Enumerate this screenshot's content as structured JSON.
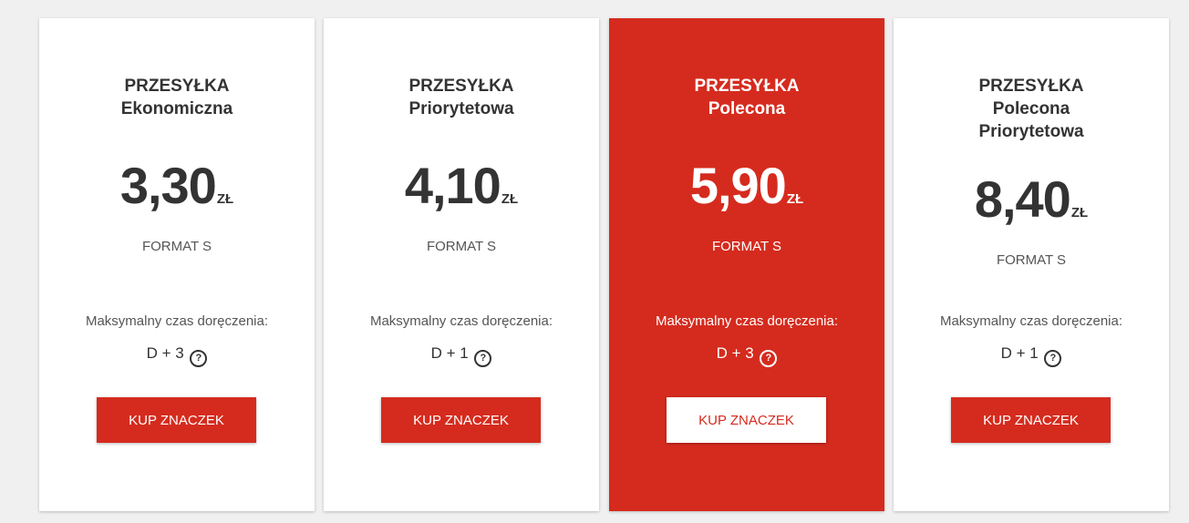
{
  "theme": {
    "accent": "#d52b1e",
    "text": "#333333",
    "card_bg": "#ffffff",
    "page_bg": "#f0f0f0"
  },
  "cards": [
    {
      "title_line1": "PRZESYŁKA",
      "title_line2": "Ekonomiczna",
      "title_line3": "",
      "price": "3,30",
      "currency": "ZŁ",
      "format": "FORMAT S",
      "delivery_label": "Maksymalny czas doręczenia:",
      "delivery_value": "D + 3",
      "help_icon": "question-circle-icon",
      "help_glyph": "?",
      "button_label": "KUP ZNACZEK",
      "featured": false
    },
    {
      "title_line1": "PRZESYŁKA",
      "title_line2": "Priorytetowa",
      "title_line3": "",
      "price": "4,10",
      "currency": "ZŁ",
      "format": "FORMAT S",
      "delivery_label": "Maksymalny czas doręczenia:",
      "delivery_value": "D + 1",
      "help_icon": "question-circle-icon",
      "help_glyph": "?",
      "button_label": "KUP ZNACZEK",
      "featured": false
    },
    {
      "title_line1": "PRZESYŁKA",
      "title_line2": "Polecona",
      "title_line3": "",
      "price": "5,90",
      "currency": "ZŁ",
      "format": "FORMAT S",
      "delivery_label": "Maksymalny czas doręczenia:",
      "delivery_value": "D + 3",
      "help_icon": "question-circle-icon",
      "help_glyph": "?",
      "button_label": "KUP ZNACZEK",
      "featured": true
    },
    {
      "title_line1": "PRZESYŁKA",
      "title_line2": "Polecona",
      "title_line3": "Priorytetowa",
      "price": "8,40",
      "currency": "ZŁ",
      "format": "FORMAT S",
      "delivery_label": "Maksymalny czas doręczenia:",
      "delivery_value": "D + 1",
      "help_icon": "question-circle-icon",
      "help_glyph": "?",
      "button_label": "KUP ZNACZEK",
      "featured": false
    }
  ]
}
